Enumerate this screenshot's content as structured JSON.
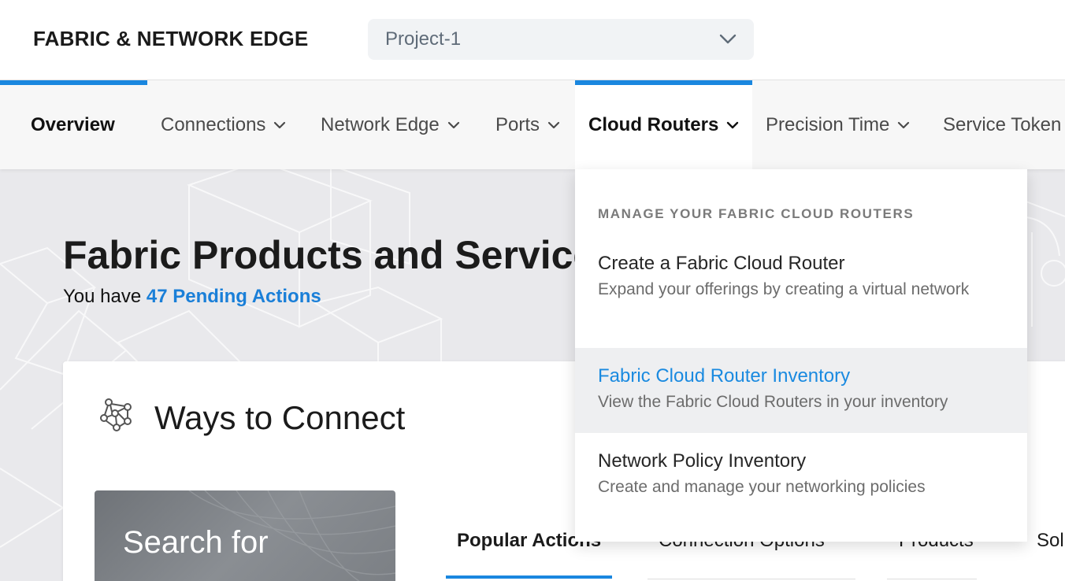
{
  "header": {
    "brand": "FABRIC & NETWORK EDGE",
    "project_select": {
      "value": "Project-1"
    }
  },
  "nav": {
    "items": [
      {
        "label": "Overview"
      },
      {
        "label": "Connections"
      },
      {
        "label": "Network Edge"
      },
      {
        "label": "Ports"
      },
      {
        "label": "Cloud Routers"
      },
      {
        "label": "Precision Time"
      },
      {
        "label": "Service Token"
      }
    ]
  },
  "dropdown": {
    "heading": "MANAGE YOUR FABRIC CLOUD ROUTERS",
    "items": [
      {
        "title": "Create a Fabric Cloud Router",
        "desc": "Expand your offerings by creating a virtual network"
      },
      {
        "title": "Fabric Cloud Router Inventory",
        "desc": "View the Fabric Cloud Routers in your inventory"
      },
      {
        "title": "Network Policy Inventory",
        "desc": "Create and manage your networking policies"
      }
    ]
  },
  "hero": {
    "title": "Fabric Products and Services",
    "pending_prefix": "You have",
    "pending_link": "47 Pending Actions"
  },
  "card": {
    "title": "Ways to Connect",
    "search_tile": "Search for",
    "tabs": [
      "Popular Actions",
      "Connection Options",
      "Products",
      "Sol"
    ]
  },
  "colors": {
    "accent": "#1a87df",
    "link": "#1a7fd8"
  }
}
